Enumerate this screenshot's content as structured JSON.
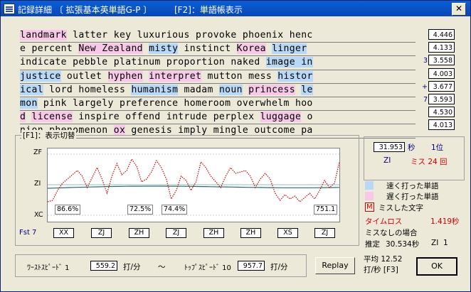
{
  "window": {
    "title": "記録詳細 〔 拡張基本英単語G-P 〕",
    "title_f2": "[F2]：単語帳表示",
    "close": "✕"
  },
  "text_lines": [
    [
      {
        "t": "landmark",
        "c": "s"
      },
      {
        "t": " latter key luxurious provoke phoenix henc"
      }
    ],
    [
      {
        "t": "e percent "
      },
      {
        "t": "New Zealand",
        "c": "s"
      },
      {
        "t": " "
      },
      {
        "t": "misty",
        "c": "f"
      },
      {
        "t": " instinct "
      },
      {
        "t": "Korea",
        "c": "s"
      },
      {
        "t": " "
      },
      {
        "t": "linger",
        "c": "f"
      }
    ],
    [
      {
        "t": "indicate pebble platinum proportion naked "
      },
      {
        "t": "image in",
        "c": "f"
      }
    ],
    [
      {
        "t": "justice",
        "c": "f"
      },
      {
        "t": " outlet "
      },
      {
        "t": "hyphen",
        "c": "s"
      },
      {
        "t": " "
      },
      {
        "t": "interpret",
        "c": "s"
      },
      {
        "t": " mutton mess "
      },
      {
        "t": "histor",
        "c": "f"
      }
    ],
    [
      {
        "t": "ical",
        "c": "f"
      },
      {
        "t": " lord homeless "
      },
      {
        "t": "humanism",
        "c": "f"
      },
      {
        "t": " madam "
      },
      {
        "t": "noun",
        "c": "f"
      },
      {
        "t": " "
      },
      {
        "t": "princess",
        "c": "s"
      },
      {
        "t": " "
      },
      {
        "t": "le",
        "c": "f"
      }
    ],
    [
      {
        "t": "mon",
        "c": "f"
      },
      {
        "t": " pink largely preference homeroom overwhelm hoo"
      }
    ],
    [
      {
        "t": "d",
        "c": "s"
      },
      {
        "t": " "
      },
      {
        "t": "license",
        "c": "s"
      },
      {
        "t": " inspire offend intrude perplex "
      },
      {
        "t": "luggage",
        "c": "s"
      },
      {
        "t": " o"
      }
    ],
    [
      {
        "t": "nion phenomenon "
      },
      {
        "t": "ox",
        "c": "s"
      },
      {
        "t": " genesis imply mingle outcome pa"
      }
    ]
  ],
  "line_marks": [
    "",
    "",
    "3",
    "",
    "+",
    "7",
    "",
    ""
  ],
  "scores": [
    "4.446",
    "4.133",
    "3.558",
    "4.003",
    "3.677",
    "3.593",
    "4.530",
    "4.013"
  ],
  "chart": {
    "label": "[F1]：表示切替",
    "ylabels": {
      "top": "ZF",
      "mid": "ZI",
      "bot": "XC"
    },
    "pct": [
      "86.6%",
      "72.5%",
      "74.4%",
      "751.1"
    ],
    "fst": "Fst  7",
    "categories": [
      "XX",
      "ZJ",
      "ZH",
      "ZJ",
      "ZH",
      "ZH",
      "XS",
      "ZJ"
    ]
  },
  "chart_data": {
    "type": "line",
    "series": [
      {
        "values": [
          -0.6,
          -0.55,
          -0.2,
          0.05,
          0.2,
          0.35,
          0.5,
          0.3,
          -0.1,
          0.25,
          0.6,
          0.2,
          -0.3,
          0.3,
          0.75,
          0.35,
          0.5,
          0.9,
          0.65,
          0.1,
          0.2,
          0.45,
          0.85,
          0.6,
          0.2,
          -0.5,
          -0.2,
          0.3,
          0.15,
          -0.2,
          0.1,
          0.8,
          0.6,
          0.3,
          0.1,
          -0.1,
          0.3,
          0.6,
          0.4,
          0.45,
          0.5,
          0.3,
          -0.1,
          0.2,
          0.4,
          0.2,
          -0.3,
          -0.55,
          -0.35,
          -0.5,
          -0.4,
          -0.6,
          -0.45,
          -0.3,
          -0.5,
          -0.2,
          0.15,
          -0.1,
          0.05,
          0.8
        ]
      }
    ]
  },
  "stats": {
    "time": "31.953",
    "time_unit": "秒",
    "rank": "1位",
    "zi": "ZI",
    "miss": "ミス 24 回"
  },
  "legend": {
    "fast": "速く打った単語",
    "slow": "遅く打った単語",
    "miss_mark": "M",
    "miss": "ミスした文字"
  },
  "timeloss": {
    "label": "タイムロス",
    "value": "1.419秒"
  },
  "nomiss": {
    "label": "ミスなしの場合",
    "est": "推定",
    "est_value": "30.534秒",
    "zi": "ZI  1"
  },
  "speed": {
    "worst_label": "ﾜｰｽﾄｽﾋﾟｰﾄﾞ 1",
    "worst": "559.2",
    "unit": "打/分",
    "tilde": "〜",
    "top_label": "ﾄｯﾌﾟｽﾋﾟｰﾄﾞ 10",
    "top": "957.7"
  },
  "avg": {
    "line1": "平均 12.52",
    "line2": "打/秒 [F3]"
  },
  "buttons": {
    "replay": "Replay",
    "ok": "OK"
  }
}
